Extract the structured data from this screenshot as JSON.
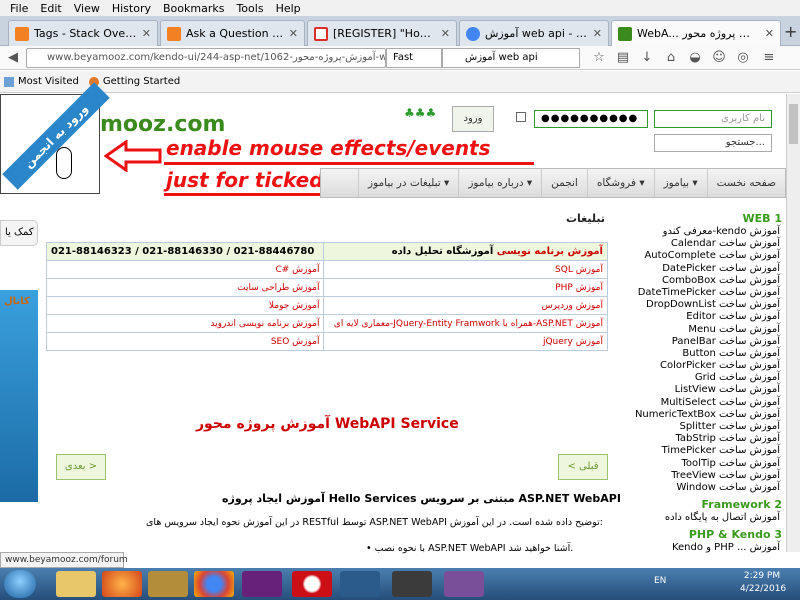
{
  "menubar": {
    "items": [
      "File",
      "Edit",
      "View",
      "History",
      "Bookmarks",
      "Tools",
      "Help"
    ]
  },
  "tabs": [
    {
      "label": "Tags - Stack Overflow",
      "icon_color": "#f48024"
    },
    {
      "label": "Ask a Question - Stack ...",
      "icon_color": "#f48024"
    },
    {
      "label": "[REGISTER] \"How to Cr...",
      "icon_color": "#d93025"
    },
    {
      "label": "آموزش web api - Google ...",
      "icon_color": "#4285f4"
    },
    {
      "label": "WebA... آموزش پروژه محور",
      "icon_color": "#3a8a1d"
    }
  ],
  "navbar": {
    "url": "www.beyamooz.com/kendo-ui/244-asp-net/1062-آموزش-پروژه-محور-webapi",
    "fast_label": "Fast",
    "search_value": "آموزش web api"
  },
  "bookmarks": [
    {
      "label": "Most Visited"
    },
    {
      "label": "Getting Started"
    }
  ],
  "header": {
    "logo_text": "mooz.com",
    "ribbon_text": "ورود به انجمن",
    "login_label": "ورود",
    "username_placeholder": "نام کاربری",
    "password_value": "●●●●●●●●●●",
    "search_placeholder": "جستجو..."
  },
  "annotation": {
    "line1": "enable mouse effects/events",
    "line2": "just for ticked part"
  },
  "sitenav": [
    "صفحه نخست",
    "بیاموز ▾",
    "فروشگاه ▾",
    "انجمن",
    "درباره بیاموز ▾",
    "تبلیغات در بیاموز ▾"
  ],
  "left": {
    "help_label": "کمک یا",
    "channel_label": "کانال"
  },
  "ads": {
    "title": "تبلیغات",
    "header_right_red": "آموزش برنامه نویسی",
    "header_right_black": "آموزشگاه تحلیل داده",
    "header_left": "021-88146323 / 021-88146330 / 021-88446780",
    "rows": [
      {
        "r": "آموزش SQL",
        "l": "آموزش #C"
      },
      {
        "r": "آموزش PHP",
        "l": "آموزش طراحی سایت"
      },
      {
        "r": "آموزش وردپرس",
        "l": "آموزش جوملا"
      },
      {
        "r": "آموزش ASP.NET-همراه با JQuery-Entity Framwork-معماری لایه ای",
        "l": "آموزش برنامه نویسی اندروید"
      },
      {
        "r": "آموزش jQuery",
        "l": "آموزش SEO"
      }
    ]
  },
  "article": {
    "title": "آموزش پروژه محور WebAPI Service",
    "prev_label": "< قبلی",
    "next_label": "بعدی >",
    "heading": "آموزش ایجاد پروژه Hello Services مبتنی بر سرویس ASP.NET WebAPI",
    "para1": "در این آموزش نحوه ایجاد سرویس های RESTful توسط ASP.NET WebAPI توضیح داده شده است. در این آموزش:",
    "para2": "• با نحوه نصب ASP.NET WebAPI آشنا خواهید شد."
  },
  "sidebar": {
    "sections": [
      {
        "title": "WEB 1",
        "items": [
          "آموزش kendo-معرفی کندو",
          "آموزش ساخت Calendar",
          "آموزش ساخت AutoComplete",
          "آموزش ساخت DatePicker",
          "آموزش ساخت ComboBox",
          "آموزش ساخت DateTimePicker",
          "آموزش ساخت DropDownList",
          "آموزش ساخت Editor",
          "آموزش ساخت Menu",
          "آموزش ساخت PanelBar",
          "آموزش ساخت Button",
          "آموزش ساخت ColorPicker",
          "آموزش ساخت Grid",
          "آموزش ساخت ListView",
          "آموزش ساخت MultiSelect",
          "آموزش ساخت NumericTextBox",
          "آموزش ساخت Splitter",
          "آموزش ساخت TabStrip",
          "آموزش ساخت TimePicker",
          "آموزش ساخت ToolTip",
          "آموزش ساخت TreeView",
          "آموزش ساخت Window"
        ]
      },
      {
        "title": "Framework 2",
        "items": [
          "آموزش اتصال به پایگاه داده"
        ]
      },
      {
        "title": "PHP & Kendo 3",
        "items": [
          "آموزش ... PHP و Kendo"
        ]
      }
    ]
  },
  "status": {
    "tooltip": "www.beyamooz.com/forum"
  },
  "taskbar": {
    "lang": "EN",
    "time": "2:29 PM",
    "date": "4/22/2016"
  }
}
